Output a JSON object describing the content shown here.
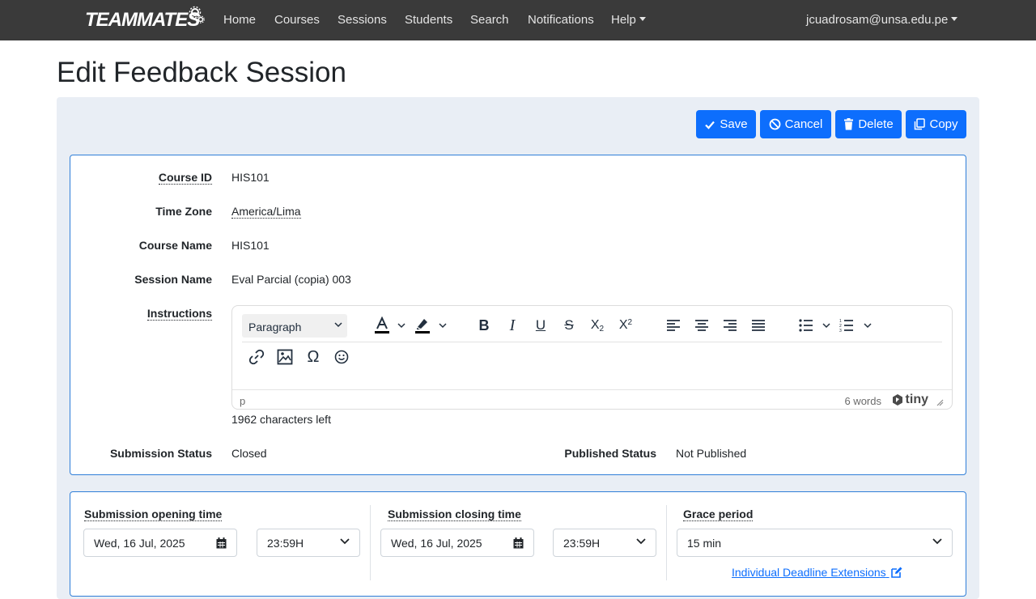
{
  "navbar": {
    "brand": "TEAMMATES",
    "items": [
      "Home",
      "Courses",
      "Sessions",
      "Students",
      "Search",
      "Notifications"
    ],
    "help": "Help",
    "user": "jcuadrosam@unsa.edu.pe"
  },
  "page": {
    "title": "Edit Feedback Session"
  },
  "actions": {
    "save": "Save",
    "cancel": "Cancel",
    "delete": "Delete",
    "copy": "Copy"
  },
  "details": {
    "course_id_label": "Course ID",
    "course_id": "HIS101",
    "time_zone_label": "Time Zone",
    "time_zone": "America/Lima",
    "course_name_label": "Course Name",
    "course_name": "HIS101",
    "session_name_label": "Session Name",
    "session_name": "Eval Parcial (copia) 003",
    "instructions_label": "Instructions",
    "submission_status_label": "Submission Status",
    "submission_status": "Closed",
    "published_status_label": "Published Status",
    "published_status": "Not Published"
  },
  "editor": {
    "block_format": "Paragraph",
    "path": "p",
    "word_count": "6 words",
    "branding": "tiny",
    "chars_left": "1962 characters left"
  },
  "timing": {
    "opening_label": "Submission opening time",
    "opening_date": "Wed, 16 Jul, 2025",
    "opening_time": "23:59H",
    "closing_label": "Submission closing time",
    "closing_date": "Wed, 16 Jul, 2025",
    "closing_time": "23:59H",
    "grace_label": "Grace period",
    "grace_value": "15 min",
    "extensions_link": "Individual Deadline Extensions"
  },
  "colors": {
    "navbar": "#3a3a3a",
    "primary": "#0d6efd",
    "panel": "#e9eef5",
    "card_border": "#2f7ed8"
  }
}
